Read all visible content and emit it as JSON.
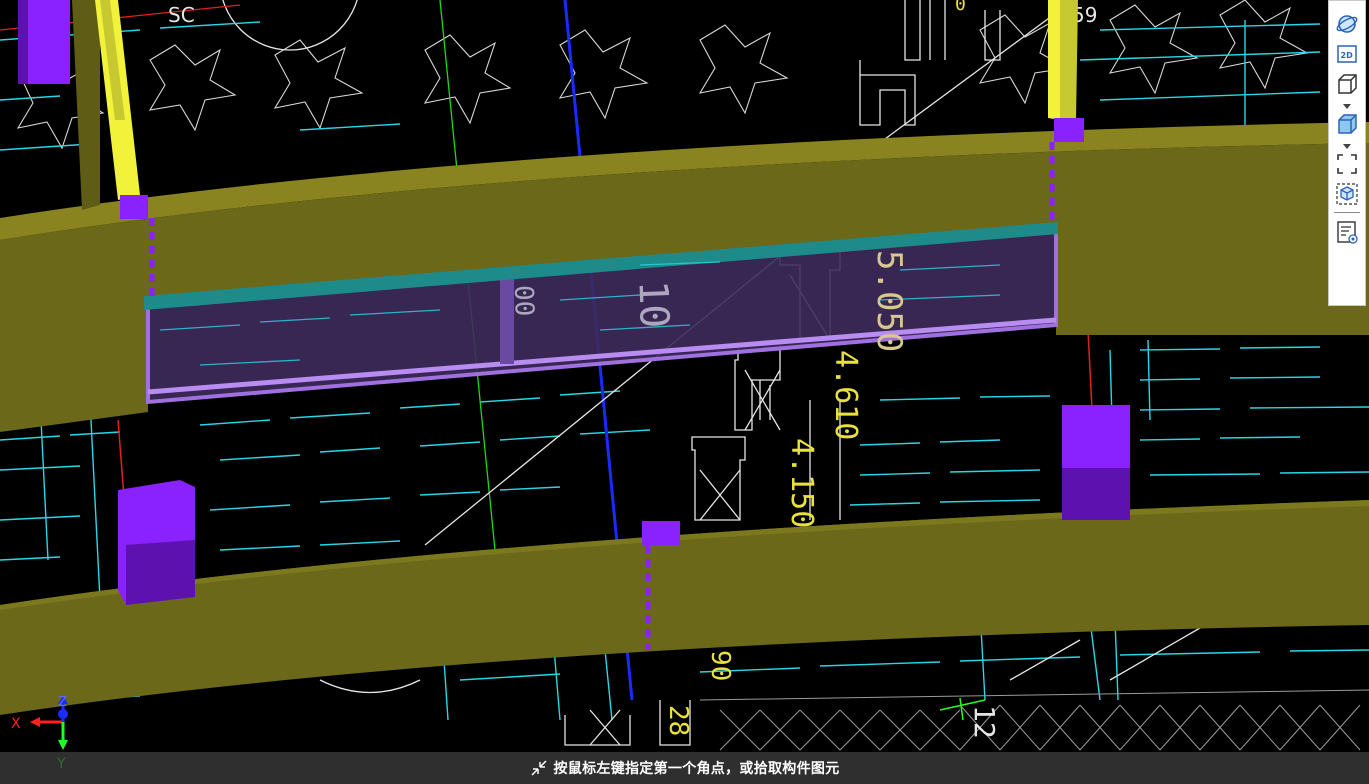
{
  "viewport": {
    "background": "#000000",
    "grid_labels": {
      "top_left": "SC",
      "top_right": "59"
    },
    "elevations": [
      "5.050",
      "4.610",
      "4.150"
    ],
    "partial_labels": [
      "90",
      "28",
      "12"
    ],
    "colors": {
      "beam": "#6b6819",
      "beam_dark": "#545212",
      "column": "#8a22ff",
      "column_dark": "#5d12b0",
      "yellow_column": "#f2f23a",
      "slab_fill": "#3e2a5c",
      "slab_edge": "#a070e0",
      "slab_top": "#1f8a8a",
      "cad_cyan": "#28d7e6",
      "cad_white": "#e6e6e6",
      "cad_yellow": "#e8e23a",
      "axis_red": "#ff2020",
      "axis_green": "#20ff20",
      "axis_blue": "#1a2bff"
    }
  },
  "toolbar": {
    "buttons": [
      {
        "name": "orbit-icon"
      },
      {
        "name": "view-2d-icon",
        "label": "2D"
      },
      {
        "name": "view-3d-wire-icon"
      },
      {
        "name": "view-3d-solid-icon"
      },
      {
        "name": "fit-view-icon"
      },
      {
        "name": "local-3d-icon"
      },
      {
        "name": "display-settings-icon"
      }
    ]
  },
  "axis": {
    "x": "X",
    "y": "Y",
    "z": "Z"
  },
  "status": {
    "message": "按鼠标左键指定第一个角点，或拾取构件图元",
    "icon": "shrink-arrows-icon"
  }
}
